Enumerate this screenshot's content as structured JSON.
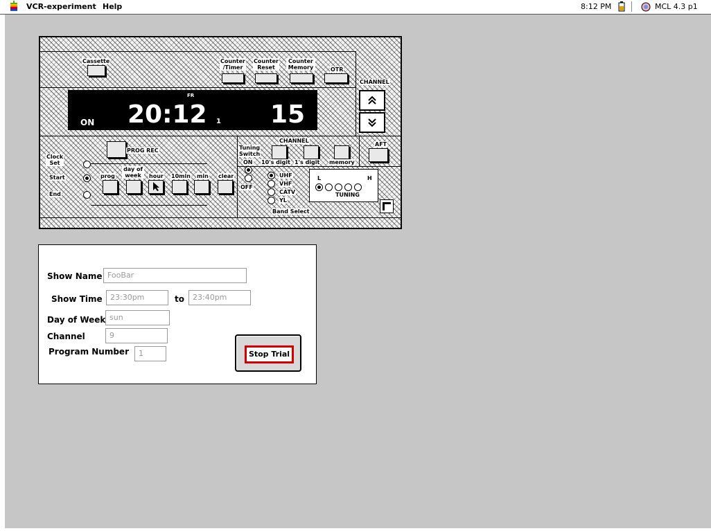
{
  "menubar": {
    "app_menu": "VCR-experiment",
    "help_menu": "Help",
    "clock": "8:12 PM",
    "app_name": "MCL 4.3 p1"
  },
  "vcr": {
    "buttons": {
      "cassette": "Cassette",
      "counter_timer": "Counter /Timer",
      "counter_reset": "Counter Reset",
      "counter_memory": "Counter Memory",
      "otr": "OTR",
      "prog_rec": "PROG REC",
      "prog": "prog",
      "day_of_week": "day of week",
      "hour": "hour",
      "tenmin": "10min",
      "min": "min",
      "clear": "clear",
      "tens_digit": "10's digit",
      "ones_digit": "1's digit",
      "memory": "memory",
      "aft": "AFT"
    },
    "channel_label": "CHANNEL",
    "channel_label_2": "CHANNEL",
    "display": {
      "day": "FR",
      "status": "ON",
      "time": "20:12",
      "program": "1",
      "channel": "15"
    },
    "mode": {
      "clock_set": "Clock Set",
      "start": "Start",
      "end": "End",
      "selected": "start"
    },
    "tuning_switch": {
      "label": "Tuning Switch",
      "on": "ON",
      "off": "OFF",
      "selected": "on"
    },
    "band": {
      "label": "Band Select",
      "options": [
        "UHF",
        "VHF",
        "CATV",
        "YL"
      ],
      "selected": "UHF"
    },
    "tuning": {
      "label": "TUNING",
      "low": "L",
      "high": "H"
    },
    "icons": {
      "channel_up": "double-chevron-up",
      "channel_down": "double-chevron-down",
      "cursor": "arrow-cursor"
    }
  },
  "info": {
    "show_name_label": "Show Name",
    "show_name_value": "FooBar",
    "show_time_label": "Show Time",
    "show_time_start": "23:30pm",
    "to_label": "to",
    "show_time_end": "23:40pm",
    "day_label": "Day of Week",
    "day_value": "sun",
    "channel_label": "Channel",
    "channel_value": "9",
    "program_label": "Program Number",
    "program_value": "1",
    "stop_button": "Stop Trial"
  },
  "colors": {
    "desktop": "#c6c6c6",
    "stop_border": "#d40000"
  }
}
